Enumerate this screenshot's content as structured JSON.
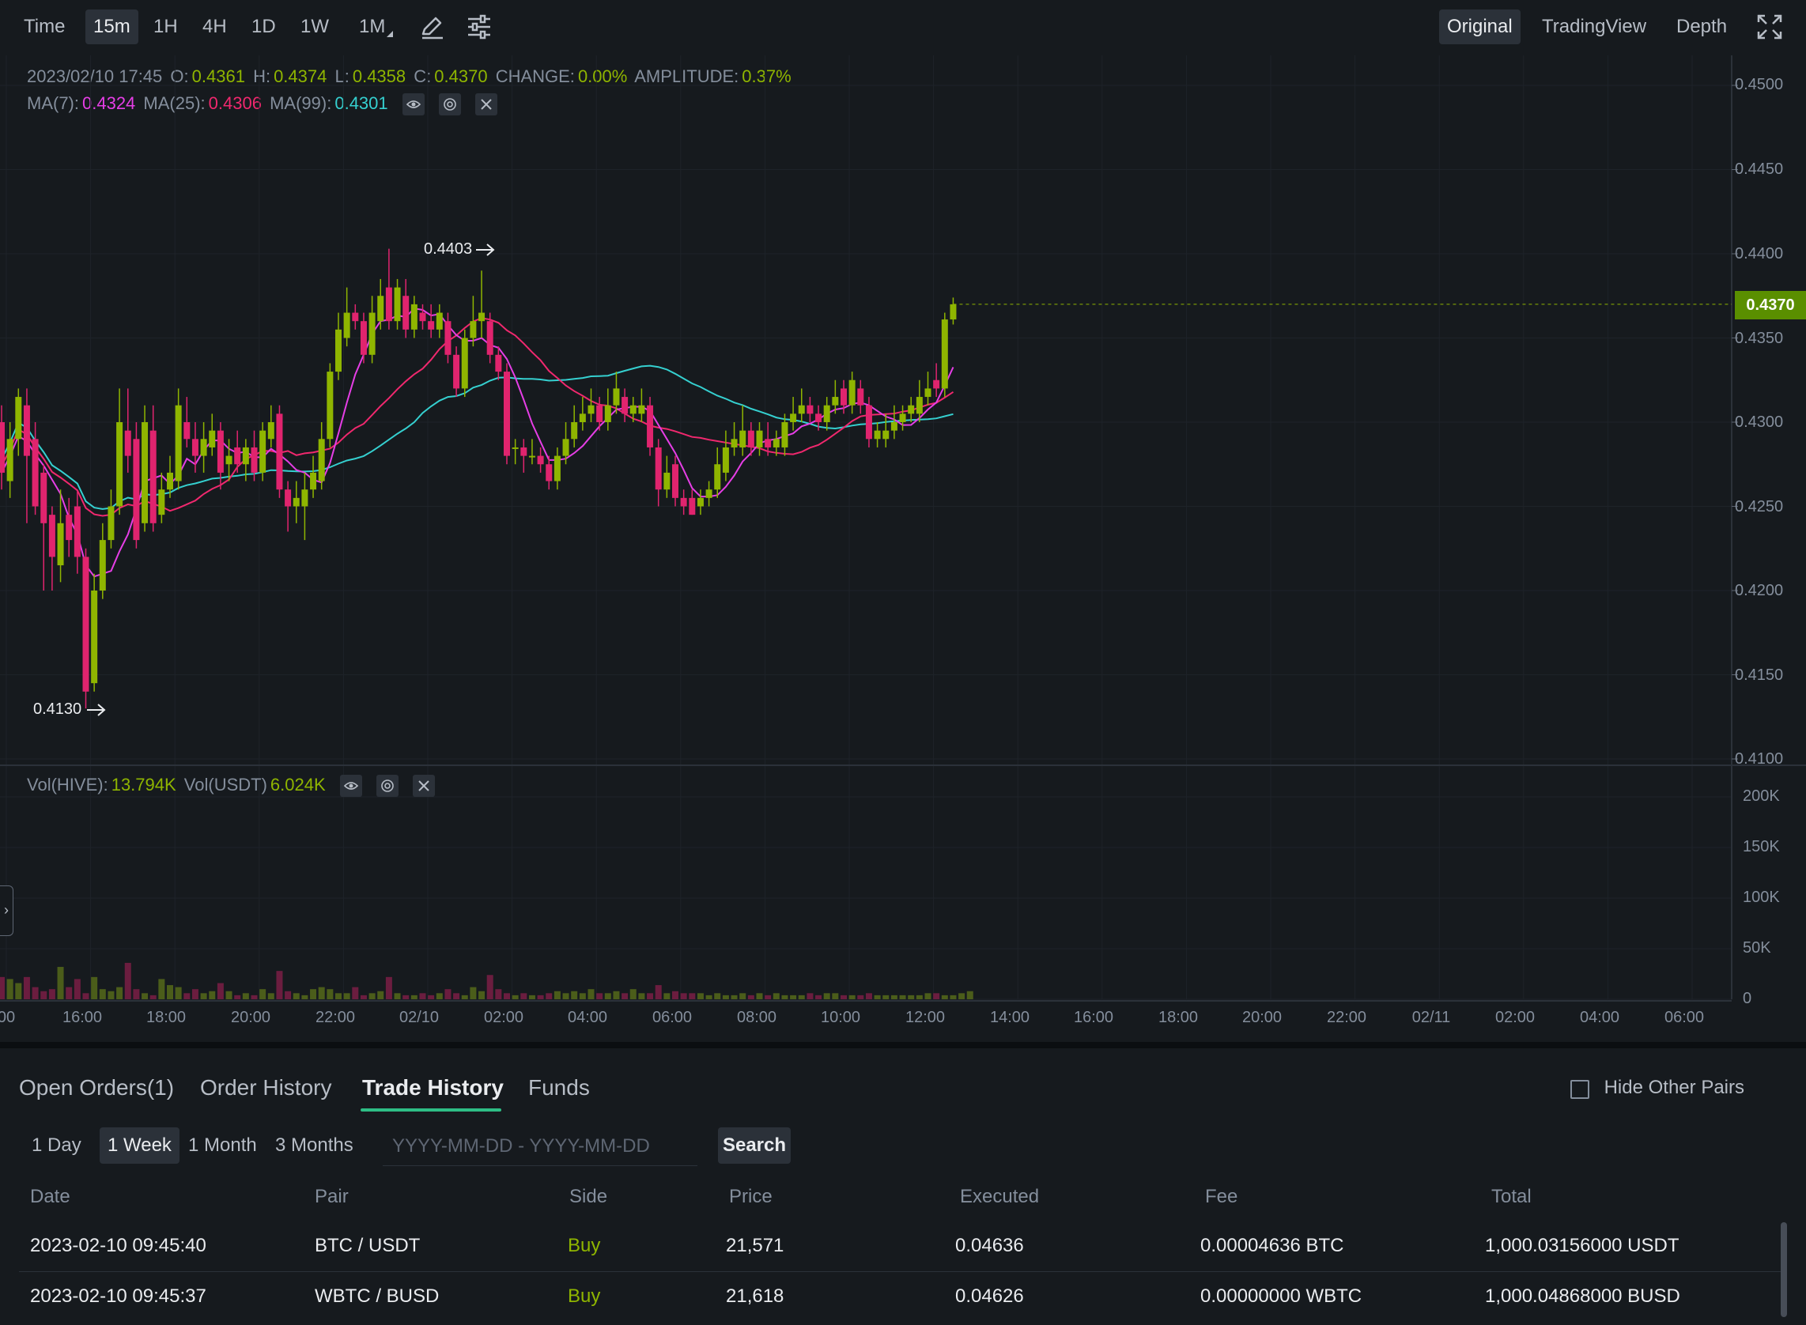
{
  "toolbar": {
    "left": [
      "Time",
      "15m",
      "1H",
      "4H",
      "1D",
      "1W",
      "1M"
    ],
    "active_interval": "15m",
    "icons": [
      "pencil-draw-icon",
      "settings-sliders-icon"
    ],
    "views": [
      "Original",
      "TradingView",
      "Depth"
    ],
    "active_view": "Original",
    "fullscreen_icon": "fullscreen-icon"
  },
  "ohlc": {
    "date": "2023/02/10 17:45",
    "o_label": "O:",
    "o": "0.4361",
    "h_label": "H:",
    "h": "0.4374",
    "l_label": "L:",
    "l": "0.4358",
    "c_label": "C:",
    "c": "0.4370",
    "change_label": "CHANGE:",
    "change": "0.00%",
    "amplitude_label": "AMPLITUDE:",
    "amplitude": "0.37%"
  },
  "ma": {
    "ma7_label": "MA(7):",
    "ma7": "0.4324",
    "ma25_label": "MA(25):",
    "ma25": "0.4306",
    "ma99_label": "MA(99):",
    "ma99": "0.4301"
  },
  "volume": {
    "hive_label": "Vol(HIVE):",
    "hive": "13.794K",
    "usdt_label": "Vol(USDT)",
    "usdt": "6.024K"
  },
  "price_axis": [
    "0.4500",
    "0.4450",
    "0.4400",
    "0.4350",
    "0.4300",
    "0.4250",
    "0.4200",
    "0.4150",
    "0.4100"
  ],
  "last_price": "0.4370",
  "high_marker": "0.4403",
  "low_marker": "0.4130",
  "volume_axis": [
    "200K",
    "150K",
    "100K",
    "50K",
    "0"
  ],
  "time_axis": [
    "00",
    "16:00",
    "18:00",
    "20:00",
    "22:00",
    "02/10",
    "02:00",
    "04:00",
    "06:00",
    "08:00",
    "10:00",
    "12:00",
    "14:00",
    "16:00",
    "18:00",
    "20:00",
    "22:00",
    "02/11",
    "02:00",
    "04:00",
    "06:00"
  ],
  "colors": {
    "up": "#8fb500",
    "down": "#e0246e",
    "ma7": "#e63ee6",
    "ma25": "#f0286e",
    "ma99": "#35d0d0",
    "accent": "#2ebd85"
  },
  "tabs": [
    "Open Orders(1)",
    "Order History",
    "Trade History",
    "Funds"
  ],
  "active_tab": "Trade History",
  "hide_other_pairs": "Hide Other Pairs",
  "ranges": [
    "1 Day",
    "1 Week",
    "1 Month",
    "3 Months"
  ],
  "active_range": "1 Week",
  "date_placeholder": "YYYY-MM-DD - YYYY-MM-DD",
  "search_label": "Search",
  "table": {
    "headers": [
      "Date",
      "Pair",
      "Side",
      "Price",
      "Executed",
      "Fee",
      "Total"
    ],
    "rows": [
      [
        "2023-02-10 09:45:40",
        "BTC / USDT",
        "Buy",
        "21,571",
        "0.04636",
        "0.00004636 BTC",
        "1,000.03156000 USDT"
      ],
      [
        "2023-02-10 09:45:37",
        "WBTC / BUSD",
        "Buy",
        "21,618",
        "0.04626",
        "0.00000000 WBTC",
        "1,000.04868000 BUSD"
      ]
    ]
  },
  "chart_data": {
    "type": "candlestick",
    "interval": "15m",
    "price_range": [
      0.41,
      0.45
    ],
    "volume_range": [
      0,
      200000
    ],
    "candles": [
      [
        0.43,
        0.427,
        0.431,
        0.426,
        0
      ],
      [
        0.4265,
        0.429,
        0.43,
        0.4255,
        1
      ],
      [
        0.429,
        0.4315,
        0.432,
        0.428,
        1
      ],
      [
        0.431,
        0.428,
        0.432,
        0.424,
        0
      ],
      [
        0.429,
        0.425,
        0.43,
        0.4245,
        0
      ],
      [
        0.427,
        0.424,
        0.4275,
        0.42,
        0
      ],
      [
        0.4245,
        0.422,
        0.425,
        0.42,
        0
      ],
      [
        0.4215,
        0.424,
        0.426,
        0.4205,
        1
      ],
      [
        0.4245,
        0.423,
        0.4255,
        0.422,
        0
      ],
      [
        0.425,
        0.422,
        0.426,
        0.421,
        0
      ],
      [
        0.422,
        0.414,
        0.4225,
        0.413,
        0
      ],
      [
        0.4145,
        0.42,
        0.421,
        0.414,
        1
      ],
      [
        0.42,
        0.423,
        0.424,
        0.4195,
        1
      ],
      [
        0.423,
        0.425,
        0.426,
        0.4225,
        1
      ],
      [
        0.425,
        0.43,
        0.432,
        0.4245,
        1
      ],
      [
        0.4295,
        0.428,
        0.432,
        0.427,
        0
      ],
      [
        0.429,
        0.423,
        0.43,
        0.4225,
        0
      ],
      [
        0.424,
        0.43,
        0.431,
        0.4235,
        1
      ],
      [
        0.4295,
        0.424,
        0.431,
        0.4235,
        0
      ],
      [
        0.4245,
        0.426,
        0.427,
        0.424,
        1
      ],
      [
        0.426,
        0.427,
        0.428,
        0.4255,
        1
      ],
      [
        0.4265,
        0.431,
        0.432,
        0.426,
        1
      ],
      [
        0.43,
        0.429,
        0.4315,
        0.4285,
        0
      ],
      [
        0.429,
        0.428,
        0.43,
        0.427,
        0
      ],
      [
        0.428,
        0.429,
        0.43,
        0.427,
        1
      ],
      [
        0.4285,
        0.4295,
        0.4305,
        0.428,
        1
      ],
      [
        0.4295,
        0.427,
        0.43,
        0.426,
        0
      ],
      [
        0.4275,
        0.428,
        0.429,
        0.4265,
        1
      ],
      [
        0.4285,
        0.4275,
        0.4295,
        0.427,
        0
      ],
      [
        0.4275,
        0.4285,
        0.429,
        0.4265,
        1
      ],
      [
        0.4285,
        0.427,
        0.4295,
        0.4265,
        0
      ],
      [
        0.427,
        0.4295,
        0.43,
        0.4265,
        1
      ],
      [
        0.429,
        0.43,
        0.431,
        0.4285,
        1
      ],
      [
        0.4305,
        0.426,
        0.431,
        0.4255,
        0
      ],
      [
        0.426,
        0.425,
        0.4265,
        0.4235,
        0
      ],
      [
        0.425,
        0.4255,
        0.4265,
        0.424,
        1
      ],
      [
        0.425,
        0.426,
        0.427,
        0.423,
        1
      ],
      [
        0.426,
        0.427,
        0.428,
        0.4255,
        1
      ],
      [
        0.4265,
        0.429,
        0.43,
        0.426,
        1
      ],
      [
        0.429,
        0.433,
        0.4335,
        0.4285,
        1
      ],
      [
        0.433,
        0.4355,
        0.4365,
        0.4325,
        1
      ],
      [
        0.435,
        0.4365,
        0.438,
        0.4345,
        1
      ],
      [
        0.4365,
        0.436,
        0.437,
        0.4355,
        0
      ],
      [
        0.436,
        0.434,
        0.4365,
        0.4335,
        0
      ],
      [
        0.434,
        0.4365,
        0.4375,
        0.4335,
        1
      ],
      [
        0.436,
        0.4375,
        0.4385,
        0.4355,
        1
      ],
      [
        0.438,
        0.436,
        0.4403,
        0.4355,
        0
      ],
      [
        0.436,
        0.438,
        0.4385,
        0.4355,
        1
      ],
      [
        0.4375,
        0.4355,
        0.4385,
        0.435,
        0
      ],
      [
        0.4355,
        0.437,
        0.4375,
        0.435,
        1
      ],
      [
        0.4365,
        0.436,
        0.437,
        0.4355,
        0
      ],
      [
        0.436,
        0.4355,
        0.437,
        0.435,
        0
      ],
      [
        0.4355,
        0.4365,
        0.437,
        0.435,
        1
      ],
      [
        0.436,
        0.434,
        0.4365,
        0.4335,
        0
      ],
      [
        0.434,
        0.432,
        0.4345,
        0.4315,
        0
      ],
      [
        0.432,
        0.435,
        0.4355,
        0.4315,
        1
      ],
      [
        0.435,
        0.436,
        0.4375,
        0.4345,
        1
      ],
      [
        0.436,
        0.4365,
        0.439,
        0.435,
        1
      ],
      [
        0.436,
        0.434,
        0.4365,
        0.4335,
        0
      ],
      [
        0.434,
        0.433,
        0.4345,
        0.4325,
        0
      ],
      [
        0.433,
        0.428,
        0.4335,
        0.4275,
        0
      ],
      [
        0.4285,
        0.4285,
        0.429,
        0.4275,
        1
      ],
      [
        0.4285,
        0.428,
        0.429,
        0.427,
        0
      ],
      [
        0.428,
        0.428,
        0.429,
        0.4275,
        1
      ],
      [
        0.428,
        0.4275,
        0.4285,
        0.427,
        0
      ],
      [
        0.4275,
        0.4265,
        0.428,
        0.426,
        0
      ],
      [
        0.4265,
        0.428,
        0.4285,
        0.426,
        1
      ],
      [
        0.428,
        0.429,
        0.43,
        0.4275,
        1
      ],
      [
        0.429,
        0.43,
        0.431,
        0.4285,
        1
      ],
      [
        0.43,
        0.4305,
        0.4315,
        0.4295,
        1
      ],
      [
        0.4305,
        0.431,
        0.432,
        0.43,
        1
      ],
      [
        0.431,
        0.43,
        0.4315,
        0.4295,
        0
      ],
      [
        0.43,
        0.431,
        0.432,
        0.4295,
        1
      ],
      [
        0.431,
        0.432,
        0.433,
        0.4305,
        1
      ],
      [
        0.4315,
        0.4305,
        0.432,
        0.43,
        0
      ],
      [
        0.4305,
        0.431,
        0.4315,
        0.43,
        1
      ],
      [
        0.4305,
        0.431,
        0.432,
        0.43,
        1
      ],
      [
        0.431,
        0.4285,
        0.4315,
        0.428,
        0
      ],
      [
        0.4285,
        0.426,
        0.429,
        0.425,
        0
      ],
      [
        0.426,
        0.427,
        0.428,
        0.4255,
        1
      ],
      [
        0.4275,
        0.4255,
        0.428,
        0.425,
        0
      ],
      [
        0.4255,
        0.425,
        0.426,
        0.4245,
        0
      ],
      [
        0.4255,
        0.4245,
        0.426,
        0.4245,
        0
      ],
      [
        0.425,
        0.4255,
        0.426,
        0.4245,
        1
      ],
      [
        0.4255,
        0.426,
        0.4265,
        0.425,
        1
      ],
      [
        0.426,
        0.4275,
        0.4285,
        0.4255,
        1
      ],
      [
        0.427,
        0.4285,
        0.4295,
        0.4265,
        1
      ],
      [
        0.4285,
        0.429,
        0.43,
        0.428,
        1
      ],
      [
        0.4285,
        0.4295,
        0.431,
        0.428,
        1
      ],
      [
        0.4295,
        0.4285,
        0.43,
        0.428,
        0
      ],
      [
        0.4285,
        0.4295,
        0.43,
        0.428,
        1
      ],
      [
        0.429,
        0.4285,
        0.43,
        0.428,
        0
      ],
      [
        0.4285,
        0.429,
        0.4295,
        0.428,
        1
      ],
      [
        0.4285,
        0.43,
        0.4305,
        0.428,
        1
      ],
      [
        0.43,
        0.4305,
        0.4315,
        0.4295,
        1
      ],
      [
        0.4305,
        0.431,
        0.432,
        0.43,
        1
      ],
      [
        0.431,
        0.4305,
        0.4315,
        0.43,
        0
      ],
      [
        0.4305,
        0.43,
        0.431,
        0.4295,
        0
      ],
      [
        0.43,
        0.431,
        0.4315,
        0.4295,
        1
      ],
      [
        0.431,
        0.4315,
        0.4325,
        0.4305,
        1
      ],
      [
        0.432,
        0.431,
        0.4325,
        0.4305,
        0
      ],
      [
        0.431,
        0.4325,
        0.433,
        0.4305,
        1
      ],
      [
        0.432,
        0.431,
        0.4325,
        0.4305,
        0
      ],
      [
        0.431,
        0.429,
        0.4315,
        0.4285,
        0
      ],
      [
        0.4295,
        0.429,
        0.43,
        0.4285,
        1
      ],
      [
        0.429,
        0.4295,
        0.4305,
        0.4285,
        1
      ],
      [
        0.4295,
        0.43,
        0.431,
        0.429,
        1
      ],
      [
        0.43,
        0.4305,
        0.431,
        0.4295,
        1
      ],
      [
        0.4305,
        0.431,
        0.4315,
        0.43,
        1
      ],
      [
        0.4305,
        0.4315,
        0.4325,
        0.43,
        1
      ],
      [
        0.4315,
        0.432,
        0.433,
        0.431,
        1
      ],
      [
        0.4325,
        0.432,
        0.4335,
        0.4315,
        0
      ],
      [
        0.432,
        0.4361,
        0.4365,
        0.4315,
        1
      ],
      [
        0.4361,
        0.437,
        0.4374,
        0.4358,
        1
      ]
    ],
    "volumes": [
      22,
      20,
      16,
      22,
      12,
      8,
      10,
      32,
      12,
      20,
      6,
      22,
      10,
      8,
      12,
      36,
      10,
      6,
      4,
      20,
      14,
      12,
      6,
      10,
      6,
      8,
      16,
      8,
      4,
      6,
      4,
      10,
      6,
      28,
      8,
      6,
      4,
      10,
      12,
      10,
      6,
      6,
      12,
      4,
      6,
      8,
      22,
      6,
      4,
      4,
      6,
      4,
      6,
      10,
      6,
      4,
      12,
      8,
      24,
      10,
      6,
      4,
      6,
      4,
      4,
      6,
      8,
      6,
      8,
      6,
      10,
      6,
      6,
      8,
      6,
      10,
      6,
      6,
      14,
      6,
      8,
      6,
      6,
      6,
      4,
      6,
      4,
      4,
      6,
      4,
      6,
      4,
      6,
      4,
      4,
      4,
      6,
      4,
      6,
      6,
      4,
      4,
      4,
      6,
      4,
      4,
      4,
      4,
      4,
      4,
      6,
      6,
      4,
      4,
      6,
      8
    ]
  }
}
